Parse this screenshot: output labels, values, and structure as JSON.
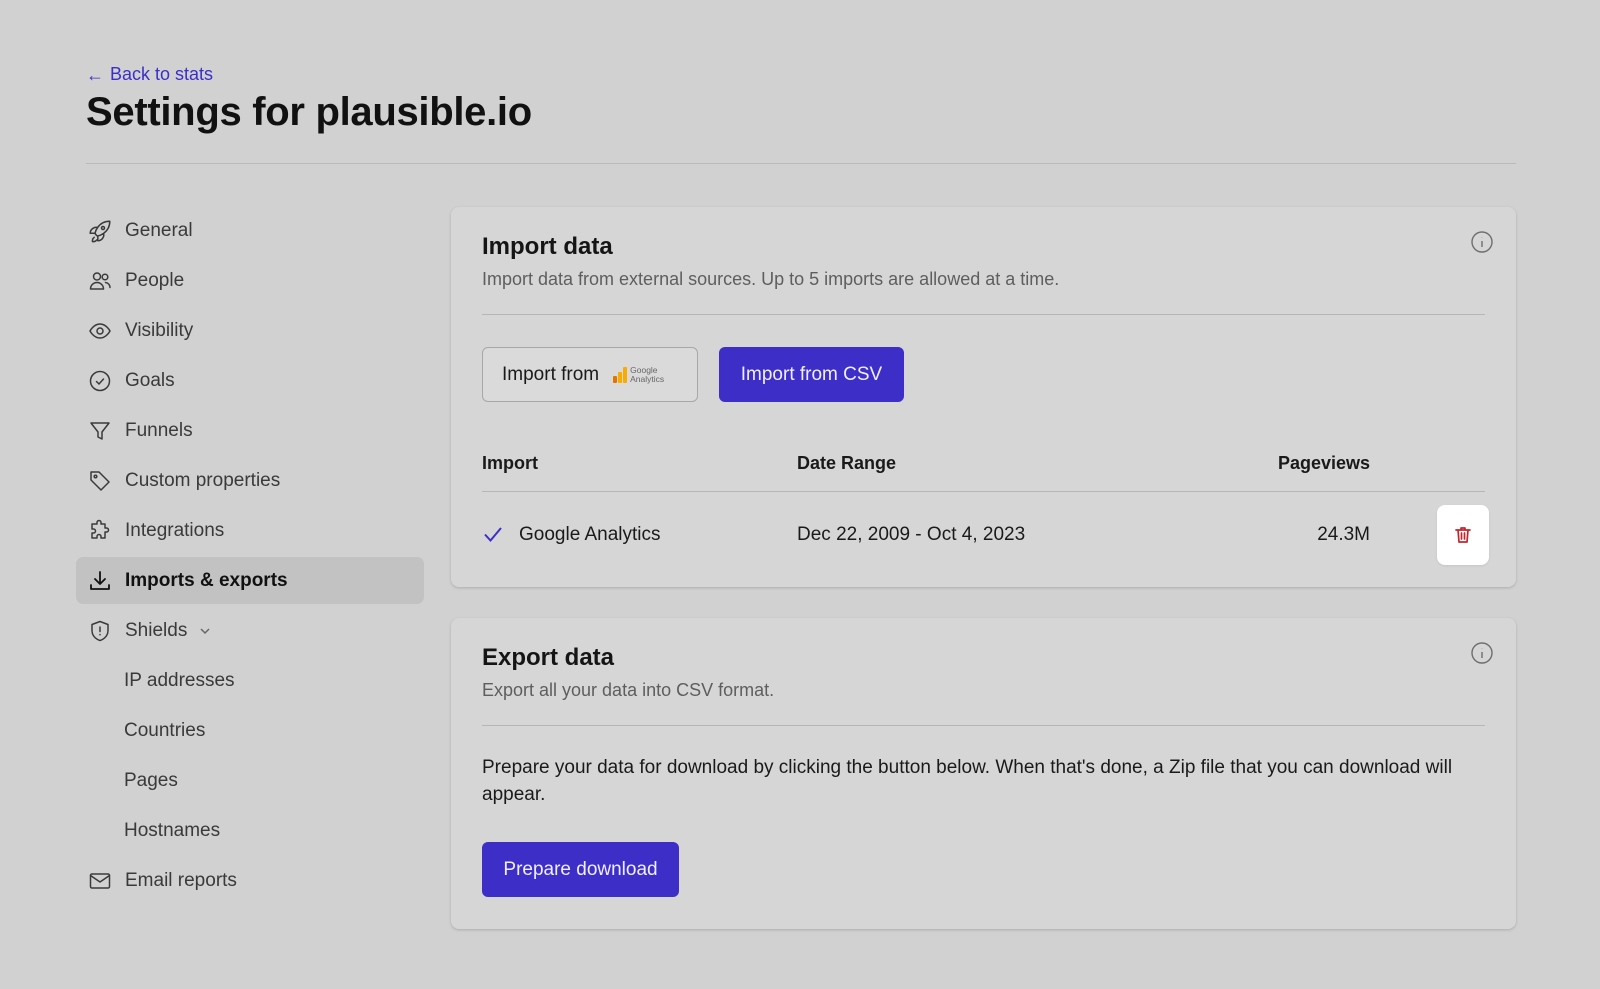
{
  "header": {
    "back_label": "Back to stats",
    "title": "Settings for plausible.io"
  },
  "sidebar": {
    "items": [
      {
        "label": "General",
        "icon": "rocket-icon"
      },
      {
        "label": "People",
        "icon": "people-icon"
      },
      {
        "label": "Visibility",
        "icon": "eye-icon"
      },
      {
        "label": "Goals",
        "icon": "check-circle-icon"
      },
      {
        "label": "Funnels",
        "icon": "funnel-icon"
      },
      {
        "label": "Custom properties",
        "icon": "tag-icon"
      },
      {
        "label": "Integrations",
        "icon": "puzzle-icon"
      },
      {
        "label": "Imports & exports",
        "icon": "download-icon",
        "active": true
      },
      {
        "label": "Shields",
        "icon": "shield-icon"
      }
    ],
    "shields_sub": [
      "IP addresses",
      "Countries",
      "Pages",
      "Hostnames"
    ],
    "email_reports": {
      "label": "Email reports",
      "icon": "mail-icon"
    }
  },
  "import_card": {
    "title": "Import data",
    "description": "Import data from external sources. Up to 5 imports are allowed at a time.",
    "ga_button_label": "Import from",
    "ga_logo_text_1": "Google",
    "ga_logo_text_2": "Analytics",
    "csv_button_label": "Import from CSV",
    "table": {
      "headers": [
        "Import",
        "Date Range",
        "Pageviews"
      ],
      "rows": [
        {
          "status": "completed",
          "import": "Google Analytics",
          "date_range": "Dec 22, 2009 - Oct 4, 2023",
          "pageviews": "24.3M"
        }
      ]
    }
  },
  "export_card": {
    "title": "Export data",
    "description": "Export all your data into CSV format.",
    "body": "Prepare your data for download by clicking the button below. When that's done, a Zip file that you can download will appear.",
    "button_label": "Prepare download"
  },
  "colors": {
    "accent": "#3d2ec8",
    "link": "#3b2fc9",
    "danger": "#c2262e",
    "background": "#d1d1d1"
  }
}
